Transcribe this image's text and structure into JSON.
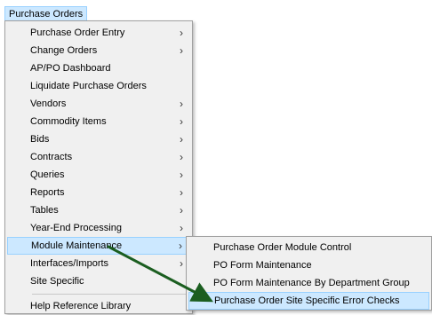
{
  "menubar": {
    "title": "Purchase Orders"
  },
  "main_menu": {
    "items": [
      {
        "label": "Purchase Order Entry",
        "arrow": "›"
      },
      {
        "label": "Change Orders",
        "arrow": "›"
      },
      {
        "label": "AP/PO Dashboard",
        "arrow": ""
      },
      {
        "label": "Liquidate Purchase Orders",
        "arrow": ""
      },
      {
        "label": "Vendors",
        "arrow": "›"
      },
      {
        "label": "Commodity Items",
        "arrow": "›"
      },
      {
        "label": "Bids",
        "arrow": "›"
      },
      {
        "label": "Contracts",
        "arrow": "›"
      },
      {
        "label": "Queries",
        "arrow": "›"
      },
      {
        "label": "Reports",
        "arrow": "›"
      },
      {
        "label": "Tables",
        "arrow": "›"
      },
      {
        "label": "Year-End Processing",
        "arrow": "›"
      },
      {
        "label": "Module Maintenance",
        "arrow": "›"
      },
      {
        "label": "Interfaces/Imports",
        "arrow": "›"
      },
      {
        "label": "Site Specific",
        "arrow": ""
      },
      {
        "label": "Help Reference Library",
        "arrow": ""
      }
    ]
  },
  "sub_menu": {
    "items": [
      {
        "label": "Purchase Order Module Control"
      },
      {
        "label": "PO Form Maintenance"
      },
      {
        "label": "PO Form Maintenance By Department Group"
      },
      {
        "label": "Purchase Order Site Specific Error Checks"
      }
    ]
  },
  "colors": {
    "highlight": "#cce8ff",
    "highlight_border": "#99d1ff",
    "arrow": "#1b5e20"
  }
}
